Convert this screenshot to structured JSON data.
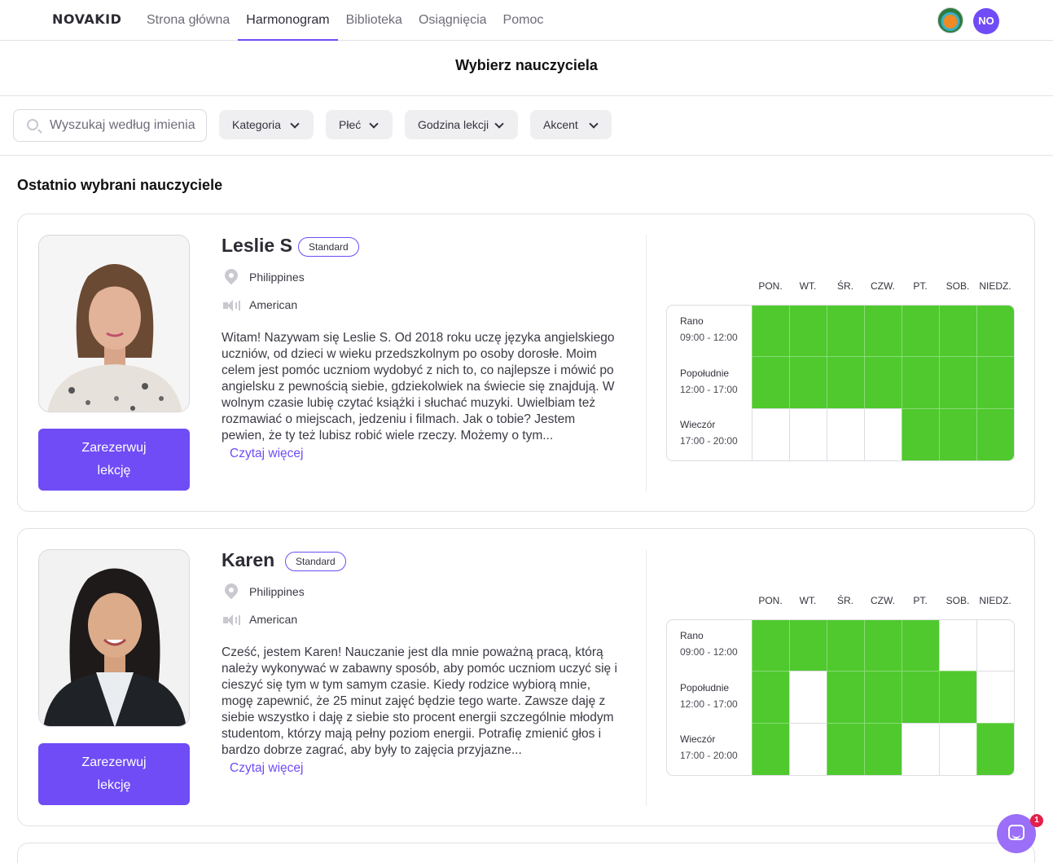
{
  "nav": {
    "logo": "NOVAKID",
    "links": [
      "Strona główna",
      "Harmonogram",
      "Biblioteka",
      "Osiągnięcia",
      "Pomoc"
    ],
    "active": "Harmonogram",
    "user_initials": "NO"
  },
  "page": {
    "title": "Wybierz nauczyciela",
    "section_title": "Ostatnio wybrani nauczyciele"
  },
  "filters": {
    "search_placeholder": "Wyszukaj według imienia",
    "dropdowns": [
      "Kategoria",
      "Płeć",
      "Godzina lekcji",
      "Akcent"
    ]
  },
  "schedule": {
    "days": [
      "PON.",
      "WT.",
      "ŚR.",
      "CZW.",
      "PT.",
      "SOB.",
      "NIEDZ."
    ],
    "slots": [
      {
        "name": "Rano",
        "time": "09:00 - 12:00"
      },
      {
        "name": "Popołudnie",
        "time": "12:00 - 17:00"
      },
      {
        "name": "Wieczór",
        "time": "17:00 - 20:00"
      }
    ]
  },
  "teachers": [
    {
      "name": "Leslie S",
      "badge": "Standard",
      "country": "Philippines",
      "accent": "American",
      "bio": "Witam! Nazywam się Leslie S. Od 2018 roku uczę języka angielskiego uczniów, od dzieci w wieku przedszkolnym po osoby dorosłe. Moim celem jest pomóc uczniom wydobyć z nich to, co najlepsze i mówić po angielsku z pewnością siebie, gdziekolwiek na świecie się znajdują. W wolnym czasie lubię czytać książki i słuchać muzyki. Uwielbiam też rozmawiać o miejscach, jedzeniu i filmach. Jak o tobie? Jestem pewien, że ty też lubisz robić wiele rzeczy. Możemy o tym...",
      "read_more": "Czytaj więcej",
      "book_label_line1": "Zarezerwuj",
      "book_label_line2": "lekcję",
      "availability": [
        [
          1,
          1,
          1,
          1,
          1,
          1,
          1
        ],
        [
          1,
          1,
          1,
          1,
          1,
          1,
          1
        ],
        [
          0,
          0,
          0,
          0,
          1,
          1,
          1
        ]
      ]
    },
    {
      "name": "Karen",
      "badge": "Standard",
      "country": "Philippines",
      "accent": "American",
      "bio": "Cześć, jestem Karen! Nauczanie jest dla mnie poważną pracą, którą należy wykonywać w zabawny sposób, aby pomóc uczniom uczyć się i cieszyć się tym w tym samym czasie. Kiedy rodzice wybiorą mnie, mogę zapewnić, że 25 minut zajęć będzie tego warte. Zawsze daję z siebie wszystko i daję z siebie sto procent energii szczególnie młodym studentom, którzy mają pełny poziom energii. Potrafię zmienić głos i bardzo dobrze zagrać, aby były to zajęcia przyjazne...",
      "read_more": "Czytaj więcej",
      "book_label_line1": "Zarezerwuj",
      "book_label_line2": "lekcję",
      "availability": [
        [
          1,
          1,
          1,
          1,
          1,
          0,
          0
        ],
        [
          1,
          0,
          1,
          1,
          1,
          1,
          0
        ],
        [
          1,
          0,
          1,
          1,
          0,
          0,
          1
        ]
      ]
    }
  ],
  "chat": {
    "unread": "1"
  },
  "colors": {
    "accent": "#6f4cf6",
    "available": "#4fc92e",
    "chat": "#9b6ff7",
    "badge": "#e3204a"
  }
}
